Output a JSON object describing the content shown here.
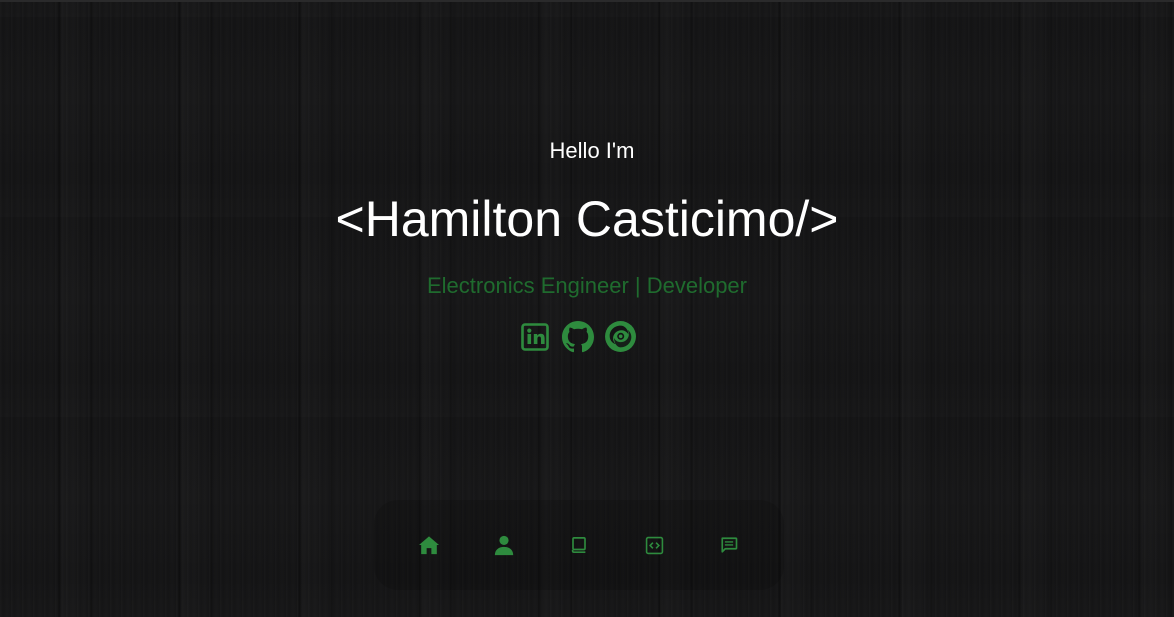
{
  "hero": {
    "greeting": "Hello I'm",
    "name": "<Hamilton Casticimo/>",
    "subtitle": "Electronics Engineer | Developer"
  },
  "socials": [
    {
      "icon": "linkedin-icon",
      "label": "LinkedIn"
    },
    {
      "icon": "github-icon",
      "label": "GitHub"
    },
    {
      "icon": "codepen-swirl-icon",
      "label": "Portfolio"
    }
  ],
  "nav": [
    {
      "icon": "home-icon",
      "label": "Home"
    },
    {
      "icon": "user-icon",
      "label": "About"
    },
    {
      "icon": "book-icon",
      "label": "Experience"
    },
    {
      "icon": "code-icon",
      "label": "Portfolio"
    },
    {
      "icon": "message-icon",
      "label": "Contact"
    }
  ],
  "colors": {
    "accent": "#2e8b3e",
    "accent_dim": "#1f6b2e",
    "background": "#141415",
    "text": "#ffffff"
  }
}
